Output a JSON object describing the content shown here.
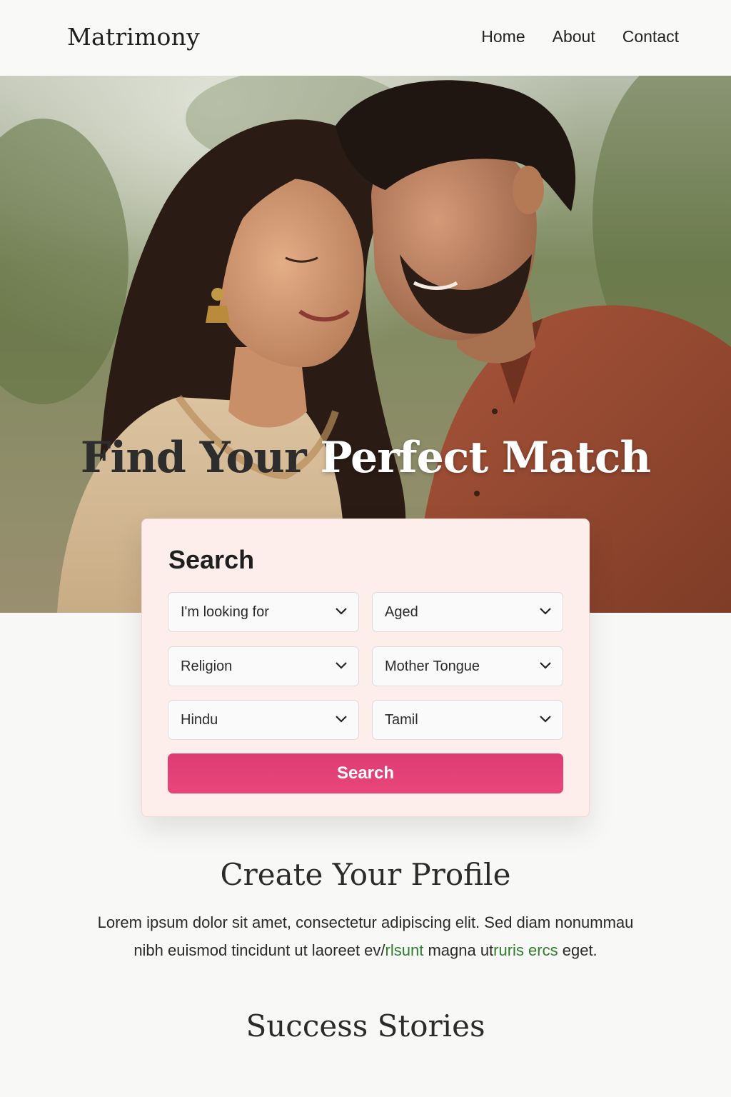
{
  "header": {
    "brand": "Matrimony",
    "nav": [
      "Home",
      "About",
      "Contact"
    ]
  },
  "hero": {
    "title_dark": "Find Your",
    "title_light": "Perfect Match",
    "image_description": "couple-photo"
  },
  "search": {
    "heading": "Search",
    "fields": [
      {
        "value": "I'm looking for"
      },
      {
        "value": "Aged"
      },
      {
        "value": "Religion"
      },
      {
        "value": "Mother Tongue"
      },
      {
        "value": "Hindu"
      },
      {
        "value": "Tamil"
      }
    ],
    "button_label": "Search"
  },
  "profile": {
    "title": "Create Your Profile",
    "text_line1": "Lorem ipsum dolor sit amet, consectetur adipiscing elit. Sed diam nonummau",
    "text_line2_a": "nibh euismod tincidunt ut laoreet ev/",
    "text_line2_b": "rlsunt",
    "text_line2_c": " magna ut",
    "text_line2_d": "ruris ercs",
    "text_line2_e": " eget."
  },
  "stories": {
    "title": "Success Stories"
  },
  "colors": {
    "accent": "#e0407a",
    "card_bg": "#fdeeec",
    "page_bg": "#f8f8f7"
  }
}
